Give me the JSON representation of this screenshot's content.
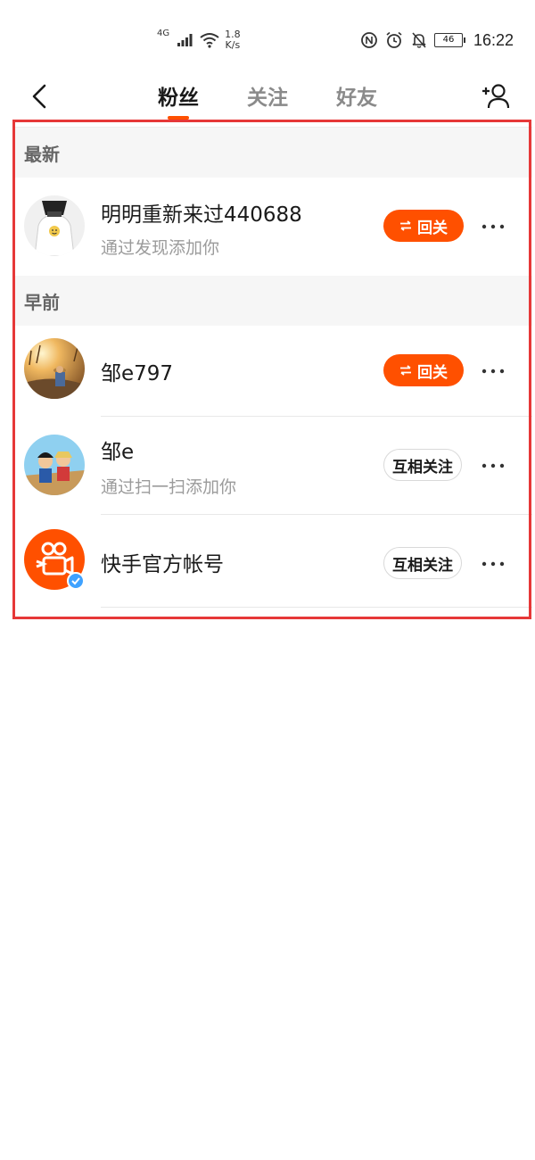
{
  "status_bar": {
    "network": "4G",
    "speed_value": "1.8",
    "speed_unit": "K/s",
    "battery": "46",
    "time": "16:22"
  },
  "header": {
    "tabs": [
      {
        "label": "粉丝",
        "active": true
      },
      {
        "label": "关注",
        "active": false
      },
      {
        "label": "好友",
        "active": false
      }
    ],
    "back_icon": "chevron-left-icon",
    "add_icon": "add-user-icon"
  },
  "sections": [
    {
      "title": "最新",
      "rows": [
        {
          "name": "明明重新来过440688",
          "sub": "通过发现添加你",
          "action": "回关",
          "action_type": "follow-back"
        }
      ]
    },
    {
      "title": "早前",
      "rows": [
        {
          "name": "邹e797",
          "sub": "",
          "action": "回关",
          "action_type": "follow-back"
        },
        {
          "name": "邹e",
          "sub": "通过扫一扫添加你",
          "action": "互相关注",
          "action_type": "mutual"
        },
        {
          "name": "快手官方帐号",
          "sub": "",
          "action": "互相关注",
          "action_type": "mutual"
        }
      ]
    }
  ],
  "colors": {
    "accent": "#ff5000",
    "highlight": "#e63838"
  }
}
